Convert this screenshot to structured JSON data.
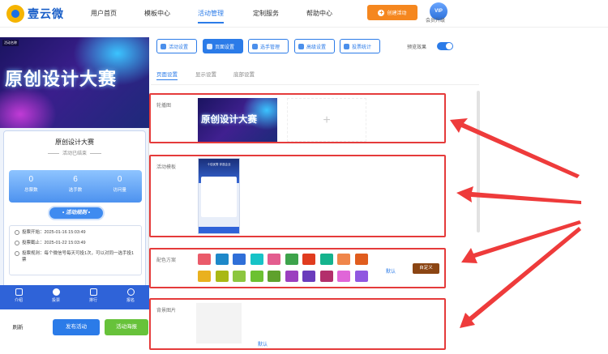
{
  "header": {
    "logo_text": "壹云微",
    "nav": [
      "用户首页",
      "模板中心",
      "活动管理",
      "定制服务",
      "帮助中心"
    ],
    "create_label": "创建活动",
    "vip_badge": "VIP",
    "vip_label": "会员升级"
  },
  "preview": {
    "banner_tag": "活动名称",
    "banner_title": "原创设计大赛",
    "card_title": "原创设计大赛",
    "card_status": "活动已结束",
    "stats": [
      {
        "value": "0",
        "label": "总票数"
      },
      {
        "value": "6",
        "label": "选手数"
      },
      {
        "value": "0",
        "label": "访问量"
      }
    ],
    "rules_label": "活动规则",
    "info": [
      "投票开始：2025-01-16 15:03:49",
      "投票截止：2025-01-22 15:03:49",
      "投票规则：每个微信号每天可投1次，可以对同一选手投1票"
    ],
    "tabs": [
      "介绍",
      "投票",
      "排行",
      "报名"
    ]
  },
  "bottom": {
    "refresh": "刷新",
    "publish": "发布活动",
    "poster": "活动海报"
  },
  "toolbar": {
    "tools": [
      "活动设置",
      "页面设置",
      "选手管理",
      "高级设置",
      "投票统计"
    ],
    "preview_label": "预览效果"
  },
  "subtabs": [
    "页面设置",
    "显示设置",
    "底部设置"
  ],
  "sections": {
    "carousel_label": "轮播图",
    "carousel_image_text": "原创设计大赛",
    "carousel_add": "+",
    "template_label": "活动模板",
    "template_thumb_text": "十佳优秀 评选企业",
    "color_label": "配色方案",
    "color_default": "默认",
    "color_custom": "自定义",
    "colors_row1": [
      "#ea5b6a",
      "#1e88c9",
      "#2f6fd8",
      "#17c3c7",
      "#e35d8f",
      "#3da34b",
      "#e03c1f",
      "#15b38d",
      "#f0864a",
      "#e05d1e"
    ],
    "colors_row2": [
      "#e9b11f",
      "#a9b815",
      "#8cc63f",
      "#6cc131",
      "#5fa12d",
      "#9b3fbf",
      "#6a3cbc",
      "#b32f6b",
      "#e066d8",
      "#9058e0"
    ],
    "bg_label": "背景图片",
    "bg_default": "默认"
  }
}
